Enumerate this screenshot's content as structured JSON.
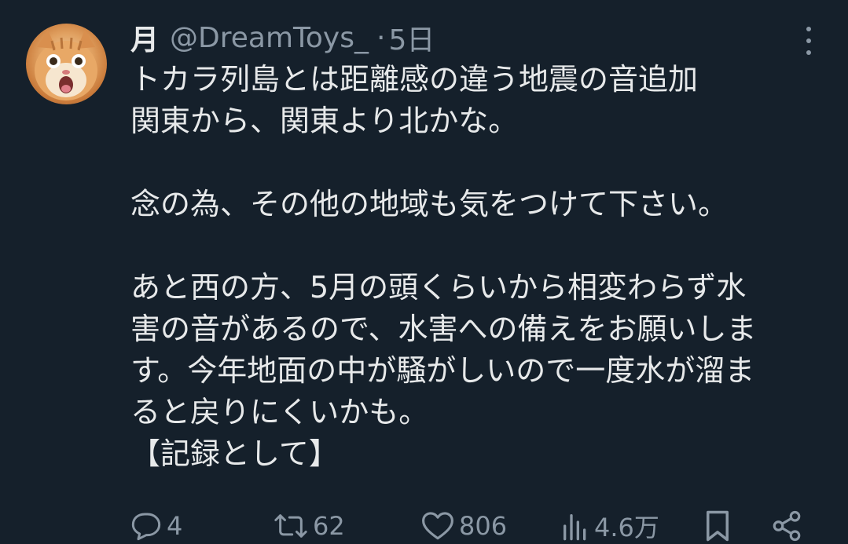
{
  "tweet": {
    "display_name": "月",
    "handle": "@DreamToys_",
    "separator": "·",
    "time": "5日",
    "lines": [
      "トカラ列島とは距離感の違う地震の音追加",
      "関東から、関東より北かな。",
      "",
      "念の為、その他の地域も気をつけて下さい。",
      "",
      "あと西の方、5月の頭くらいから相変わらず水",
      "害の音があるので、水害への備えをお願いしま",
      "す。今年地面の中が騒がしいので一度水が溜ま",
      "ると戻りにくいかも。",
      "【記録として】"
    ]
  },
  "actions": {
    "reply_count": "4",
    "retweet_count": "62",
    "like_count": "806",
    "view_count": "4.6万"
  },
  "icons": {
    "reply": "reply-icon",
    "retweet": "retweet-icon",
    "like": "heart-icon",
    "views": "bar-chart-icon",
    "bookmark": "bookmark-icon",
    "share": "share-icon",
    "more": "more-vertical-icon"
  },
  "colors": {
    "background": "#15202b",
    "text_primary": "#e7e9ea",
    "text_secondary": "#8b98a5"
  }
}
